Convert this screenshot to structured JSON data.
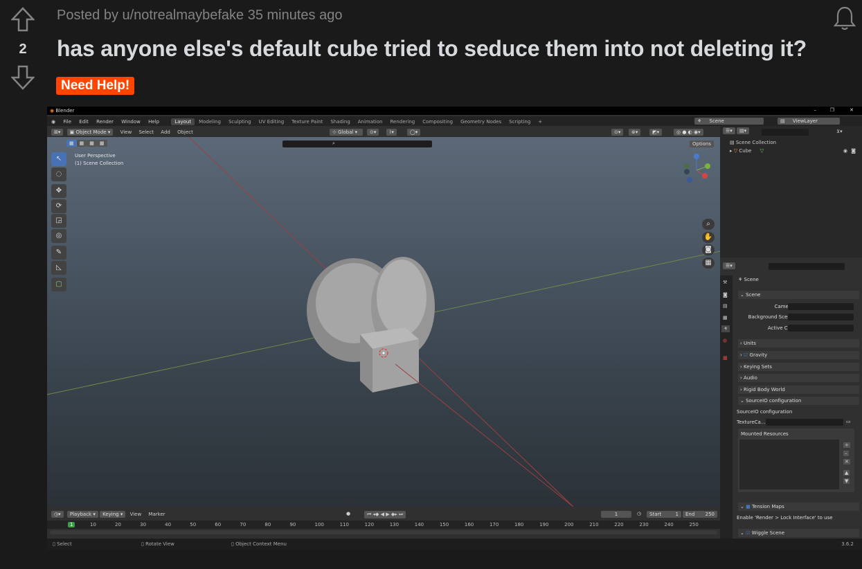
{
  "post": {
    "vote_count": "2",
    "meta": "Posted by u/notrealmaybefake 35 minutes ago",
    "title": "has anyone else's default cube tried to seduce them into not deleting it?",
    "flair": "Need Help!"
  },
  "blender": {
    "window_title": "Blender",
    "menus": [
      "File",
      "Edit",
      "Render",
      "Window",
      "Help"
    ],
    "workspaces": [
      "Layout",
      "Modeling",
      "Sculpting",
      "UV Editing",
      "Texture Paint",
      "Shading",
      "Animation",
      "Rendering",
      "Compositing",
      "Geometry Nodes",
      "Scripting"
    ],
    "active_workspace": "Layout",
    "scene": "Scene",
    "view_layer": "ViewLayer",
    "mode": "Object Mode",
    "header_menus": [
      "View",
      "Select",
      "Add",
      "Object"
    ],
    "transform": "Global",
    "options": "Options",
    "viewport_info_1": "User Perspective",
    "viewport_info_2": "(1) Scene Collection",
    "outliner": {
      "collection": "Scene Collection",
      "object": "Cube"
    },
    "properties": {
      "header": "Scene",
      "section": "Scene",
      "camera_label": "Camera",
      "bg_scene_label": "Background Scene",
      "active_clip_label": "Active Clip",
      "panels": [
        "Units",
        "Gravity",
        "Keying Sets",
        "Audio",
        "Rigid Body World",
        "SourceIO configuration"
      ],
      "sourceio_title": "SourceIO configuration",
      "texture_cache": "TextureCa...",
      "mounted": "Mounted Resources",
      "tension": "Tension Maps",
      "tension_note": "Enable 'Render > Lock Interface' to use",
      "wiggle": "Wiggle Scene"
    },
    "timeline": {
      "menus": [
        "Playback",
        "Keying",
        "View",
        "Marker"
      ],
      "current_frame": "1",
      "start_label": "Start",
      "start": "1",
      "end_label": "End",
      "end": "250",
      "ticks": [
        "1",
        "10",
        "20",
        "30",
        "40",
        "50",
        "60",
        "70",
        "80",
        "90",
        "100",
        "110",
        "120",
        "130",
        "140",
        "150",
        "160",
        "170",
        "180",
        "190",
        "200",
        "210",
        "220",
        "230",
        "240",
        "250"
      ]
    },
    "status": {
      "select": "Select",
      "rotate": "Rotate View",
      "context": "Object Context Menu",
      "version": "3.6.2"
    }
  }
}
